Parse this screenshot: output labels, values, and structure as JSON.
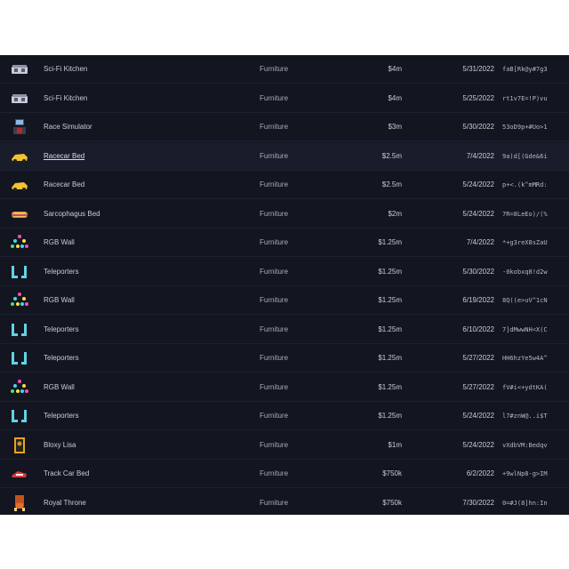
{
  "rows": [
    {
      "icon": "sci-fi-kitchen-icon",
      "name": "Sci-Fi Kitchen",
      "category": "Furniture",
      "price": "$4m",
      "date": "5/31/2022",
      "hash": "faB[Rk@y#7g3"
    },
    {
      "icon": "sci-fi-kitchen-icon",
      "name": "Sci-Fi Kitchen",
      "category": "Furniture",
      "price": "$4m",
      "date": "5/25/2022",
      "hash": "rt1v7E=!P)vu"
    },
    {
      "icon": "race-simulator-icon",
      "name": "Race Simulator",
      "category": "Furniture",
      "price": "$3m",
      "date": "5/30/2022",
      "hash": "53oD9p+#Uo>1"
    },
    {
      "icon": "racecar-bed-icon",
      "name": "Racecar Bed",
      "category": "Furniture",
      "price": "$2.5m",
      "date": "7/4/2022",
      "hash": "9a)d[(Gde&6i",
      "hover": true
    },
    {
      "icon": "racecar-bed-icon",
      "name": "Racecar Bed",
      "category": "Furniture",
      "price": "$2.5m",
      "date": "5/24/2022",
      "hash": "p+<.(k^mMRd:"
    },
    {
      "icon": "sarcophagus-bed-icon",
      "name": "Sarcophagus Bed",
      "category": "Furniture",
      "price": "$2m",
      "date": "5/24/2022",
      "hash": "7R=8LeEo)/(%"
    },
    {
      "icon": "rgb-wall-icon",
      "name": "RGB Wall",
      "category": "Furniture",
      "price": "$1.25m",
      "date": "7/4/2022",
      "hash": "*+g3reX8sZaU"
    },
    {
      "icon": "teleporters-icon",
      "name": "Teleporters",
      "category": "Furniture",
      "price": "$1.25m",
      "date": "5/30/2022",
      "hash": "-0kobxq8!d2w"
    },
    {
      "icon": "rgb-wall-icon",
      "name": "RGB Wall",
      "category": "Furniture",
      "price": "$1.25m",
      "date": "6/19/2022",
      "hash": "8Q((e>uV^1cN"
    },
    {
      "icon": "teleporters-icon",
      "name": "Teleporters",
      "category": "Furniture",
      "price": "$1.25m",
      "date": "6/10/2022",
      "hash": "7]dMwwNH<X(C"
    },
    {
      "icon": "teleporters-icon",
      "name": "Teleporters",
      "category": "Furniture",
      "price": "$1.25m",
      "date": "5/27/2022",
      "hash": "HH6hzYe5w4A^"
    },
    {
      "icon": "rgb-wall-icon",
      "name": "RGB Wall",
      "category": "Furniture",
      "price": "$1.25m",
      "date": "5/27/2022",
      "hash": "fV#i<+ydtKA("
    },
    {
      "icon": "teleporters-icon",
      "name": "Teleporters",
      "category": "Furniture",
      "price": "$1.25m",
      "date": "5/24/2022",
      "hash": "l7#znW@..i$T"
    },
    {
      "icon": "bloxy-lisa-icon",
      "name": "Bloxy Lisa",
      "category": "Furniture",
      "price": "$1m",
      "date": "5/24/2022",
      "hash": "vXdbVM:Bedqv"
    },
    {
      "icon": "track-car-bed-icon",
      "name": "Track Car Bed",
      "category": "Furniture",
      "price": "$750k",
      "date": "6/2/2022",
      "hash": "+9wlNp8-g>IM"
    },
    {
      "icon": "royal-throne-icon",
      "name": "Royal Throne",
      "category": "Furniture",
      "price": "$750k",
      "date": "7/30/2022",
      "hash": "0=#J(8]hn:In"
    }
  ]
}
